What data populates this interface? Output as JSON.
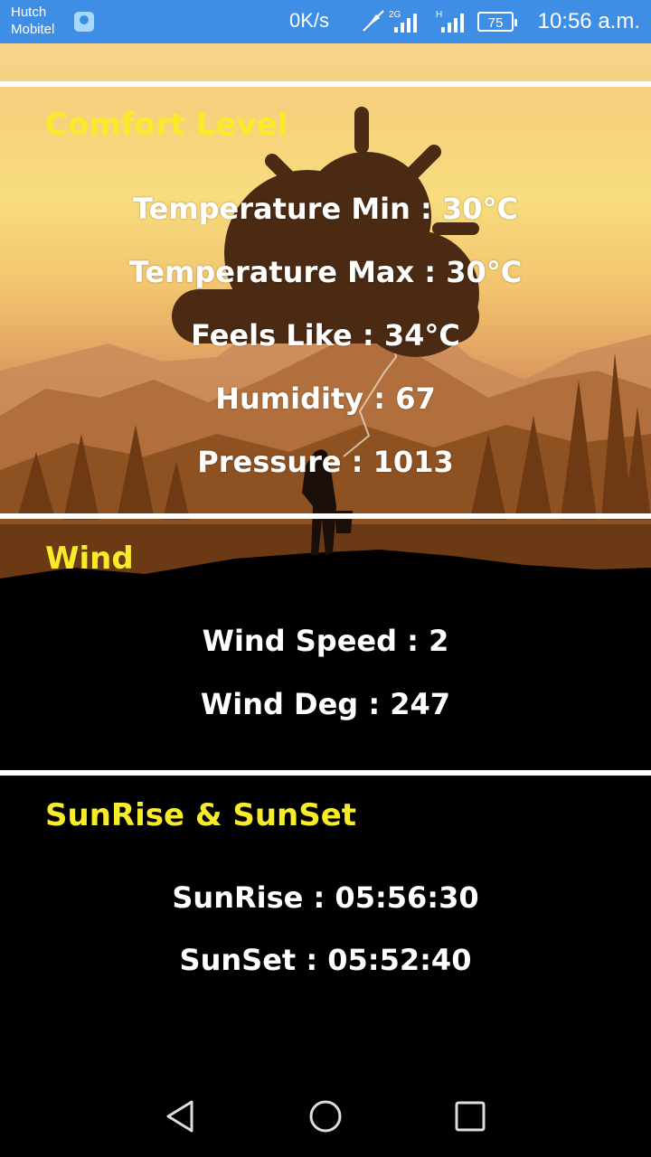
{
  "status_bar": {
    "carrier_line1": "Hutch",
    "carrier_line2": "Mobitel",
    "net_speed": "0K/s",
    "network_2g": "2G",
    "network_h": "H",
    "battery": "75",
    "clock": "10:56 a.m."
  },
  "sections": {
    "comfort": {
      "title": "Comfort Level",
      "temp_min": "Temperature Min : 30°C",
      "temp_max": "Temperature Max : 30°C",
      "feels_like": "Feels Like : 34°C",
      "humidity": "Humidity : 67",
      "pressure": "Pressure : 1013"
    },
    "wind": {
      "title": "Wind",
      "speed": "Wind Speed : 2",
      "deg": "Wind Deg : 247"
    },
    "sun": {
      "title": "SunRise & SunSet",
      "sunrise": "SunRise : 05:56:30",
      "sunset": "SunSet : 05:52:40"
    }
  },
  "colors": {
    "title_yellow": "#f8ec2a",
    "status_bar": "#3f8ee6"
  },
  "icons": [
    "weather-sun-cloud-icon",
    "back-icon",
    "home-icon",
    "recents-icon",
    "location-icon",
    "mute-icon",
    "signal-icon"
  ]
}
